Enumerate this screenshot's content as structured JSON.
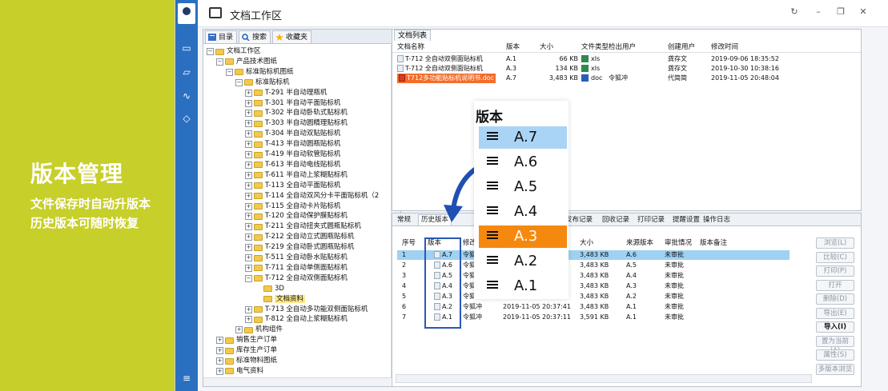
{
  "colors": {
    "promo_bg": "#c7cf2b",
    "rail": "#2b6fc0",
    "highlight_orange": "#f56d2a",
    "selected_row": "#9fd1f2",
    "popup_orange": "#f5890f",
    "popup_blue": "#aad4f5"
  },
  "promo": {
    "title": "版本管理",
    "line1": "文件保存时自动升版本",
    "line2": "历史版本可随时恢复"
  },
  "window": {
    "title": "文档工作区",
    "controls": [
      "↻",
      "–",
      "❐",
      "✕"
    ]
  },
  "rail_icons": [
    "monitor-icon",
    "folder-icon",
    "chart-icon"
  ],
  "tree_tabs": {
    "catalog": "目录",
    "search": "搜索",
    "favorites": "收藏夹"
  },
  "tree": [
    {
      "t": "文档工作区",
      "lvl": 0,
      "exp": "−"
    },
    {
      "t": "产品技术图纸",
      "lvl": 1,
      "exp": "−"
    },
    {
      "t": "标准贴标机图纸",
      "lvl": 2,
      "exp": "−"
    },
    {
      "t": "标准贴标机",
      "lvl": 3,
      "exp": "−"
    },
    {
      "t": "T-291 半自动理瓶机",
      "lvl": 4,
      "exp": "+"
    },
    {
      "t": "T-301 半自动平面贴标机",
      "lvl": 4,
      "exp": "+"
    },
    {
      "t": "T-302 半自动卧轨式贴标机",
      "lvl": 4,
      "exp": "+"
    },
    {
      "t": "T-303 半自动圆精理贴标机",
      "lvl": 4,
      "exp": "+"
    },
    {
      "t": "T-304 半自动双贴贴标机",
      "lvl": 4,
      "exp": "+"
    },
    {
      "t": "T-413 半自动圆瓶贴标机",
      "lvl": 4,
      "exp": "+"
    },
    {
      "t": "T-419 半自动软管贴标机",
      "lvl": 4,
      "exp": "+"
    },
    {
      "t": "T-613 半自动电线贴标机",
      "lvl": 4,
      "exp": "+"
    },
    {
      "t": "T-611 半自动上浆糊贴标机",
      "lvl": 4,
      "exp": "+"
    },
    {
      "t": "T-113 全自动平面贴标机",
      "lvl": 4,
      "exp": "+"
    },
    {
      "t": "T-114 全自动双风分卡平面贴标机（2",
      "lvl": 4,
      "exp": "+"
    },
    {
      "t": "T-115 全自动卡片贴标机",
      "lvl": 4,
      "exp": "+"
    },
    {
      "t": "T-120 全自动保护膜贴标机",
      "lvl": 4,
      "exp": "+"
    },
    {
      "t": "T-211 全自动扭夹式圆瓶贴标机",
      "lvl": 4,
      "exp": "+"
    },
    {
      "t": "T-212 全自动立式圆瓶贴标机",
      "lvl": 4,
      "exp": "+"
    },
    {
      "t": "T-219 全自动卧式圆瓶贴标机",
      "lvl": 4,
      "exp": "+"
    },
    {
      "t": "T-511 全自动卧水贴贴标机",
      "lvl": 4,
      "exp": "+"
    },
    {
      "t": "T-711 全自动单侧面贴标机",
      "lvl": 4,
      "exp": "+"
    },
    {
      "t": "T-712 全自动双侧面贴标机",
      "lvl": 4,
      "exp": "−"
    },
    {
      "t": "3D",
      "lvl": 5,
      "exp": ""
    },
    {
      "t": "文档资料",
      "lvl": 5,
      "exp": "",
      "sel": true
    },
    {
      "t": "T-713 全自动多功能双侧面贴标机",
      "lvl": 4,
      "exp": "+"
    },
    {
      "t": "T-812 全自动上浆糊贴标机",
      "lvl": 4,
      "exp": "+"
    },
    {
      "t": "机构组件",
      "lvl": 3,
      "exp": "+"
    },
    {
      "t": "销售生产订单",
      "lvl": 1,
      "exp": "+"
    },
    {
      "t": "库存生产订单",
      "lvl": 1,
      "exp": "+"
    },
    {
      "t": "标准物料图纸",
      "lvl": 1,
      "exp": "+"
    },
    {
      "t": "电气资料",
      "lvl": 1,
      "exp": "+"
    }
  ],
  "doc_list": {
    "tab": "文档列表",
    "headers": [
      "文档名称",
      "版本",
      "大小",
      "文件类型",
      "检出用户",
      "创建用户",
      "修改时间"
    ],
    "rows": [
      {
        "name": "T-712 全自动双侧面贴标机",
        "ver": "A.1",
        "size": "66 KB",
        "type": "xls",
        "out": "",
        "creator": "龚存文",
        "mtime": "2019-09-06 18:35:52",
        "hl": false,
        "kind": "x"
      },
      {
        "name": "T-712 全自动双侧面贴标机",
        "ver": "A.3",
        "size": "134 KB",
        "type": "xls",
        "out": "",
        "creator": "龚存文",
        "mtime": "2019-10-30 10:38:16",
        "hl": false,
        "kind": "x"
      },
      {
        "name": "T712多功能贴标机说明书.doc",
        "ver": "A.7",
        "size": "3,483 KB",
        "type": "doc",
        "out": "令狐冲",
        "creator": "代简简",
        "mtime": "2019-11-05 20:48:04",
        "hl": true,
        "kind": "w"
      }
    ]
  },
  "bottom_tabs": [
    "常规",
    "历史版本",
    "",
    "发布记录",
    "回收记录",
    "打印记录",
    "提醒设置",
    "操作日志"
  ],
  "versions": {
    "headers": [
      "序号",
      "版本",
      "修改",
      "大小",
      "来源版本",
      "审批情况",
      "版本备注"
    ],
    "rows": [
      {
        "no": "1",
        "ver": "A.7",
        "mod": "令狐",
        "time": "",
        "size": "3,483 KB",
        "src": "A.6",
        "appr": "未审批",
        "sel": true
      },
      {
        "no": "2",
        "ver": "A.6",
        "mod": "令狐",
        "time": "",
        "size": "3,483 KB",
        "src": "A.5",
        "appr": "未审批"
      },
      {
        "no": "3",
        "ver": "A.5",
        "mod": "令狐",
        "time": "",
        "size": "3,483 KB",
        "src": "A.4",
        "appr": "未审批"
      },
      {
        "no": "4",
        "ver": "A.4",
        "mod": "令狐",
        "time": "",
        "size": "3,483 KB",
        "src": "A.3",
        "appr": "未审批"
      },
      {
        "no": "5",
        "ver": "A.3",
        "mod": "令狐",
        "time": "",
        "size": "3,483 KB",
        "src": "A.2",
        "appr": "未审批"
      },
      {
        "no": "6",
        "ver": "A.2",
        "mod": "令狐冲",
        "time": "2019-11-05 20:37:41",
        "size": "3,483 KB",
        "src": "A.1",
        "appr": "未审批"
      },
      {
        "no": "7",
        "ver": "A.1",
        "mod": "令狐冲",
        "time": "2019-11-05 20:37:11",
        "size": "3,591 KB",
        "src": "A.1",
        "appr": "未审批"
      }
    ]
  },
  "side_buttons": [
    {
      "label": "浏览(L)",
      "on": false
    },
    {
      "label": "比较(C)",
      "on": false
    },
    {
      "label": "打印(P)",
      "on": false
    },
    {
      "label": "打开",
      "on": false
    },
    {
      "label": "删除(D)",
      "on": false
    },
    {
      "label": "导出(E)",
      "on": false
    },
    {
      "label": "导入(I)",
      "on": true
    },
    {
      "label": "置为当前(A)",
      "on": false
    },
    {
      "label": "属性(S)",
      "on": false
    },
    {
      "label": "多版本浏览",
      "on": false
    }
  ],
  "popup": {
    "title": "版本",
    "items": [
      {
        "label": "A.7",
        "style": "blue"
      },
      {
        "label": "A.6",
        "style": ""
      },
      {
        "label": "A.5",
        "style": ""
      },
      {
        "label": "A.4",
        "style": ""
      },
      {
        "label": "A.3",
        "style": "orange"
      },
      {
        "label": "A.2",
        "style": ""
      },
      {
        "label": "A.1",
        "style": ""
      }
    ]
  }
}
